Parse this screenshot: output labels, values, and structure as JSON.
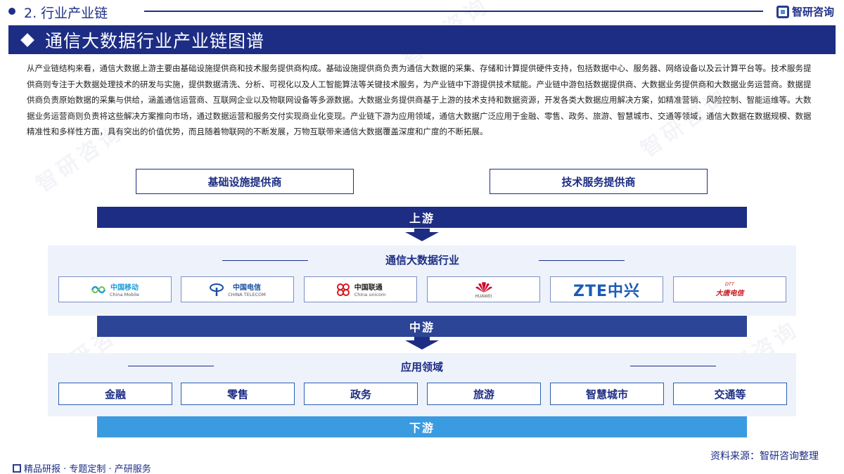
{
  "header": {
    "section": "2. 行业产业链",
    "brand": "智研咨询"
  },
  "title": "通信大数据行业产业链图谱",
  "intro": "从产业链结构来看，通信大数据上游主要由基础设施提供商和技术服务提供商构成。基础设施提供商负责为通信大数据的采集、存储和计算提供硬件支持，包括数据中心、服务器、网络设备以及云计算平台等。技术服务提供商则专注于大数据处理技术的研发与实施，提供数据清洗、分析、可视化以及人工智能算法等关键技术服务，为产业链中下游提供技术赋能。产业链中游包括数据提供商、大数据业务提供商和大数据业务运营商。数据提供商负责原始数据的采集与供给，涵盖通信运营商、互联网企业以及物联网设备等多源数据。大数据业务提供商基于上游的技术支持和数据资源，开发各类大数据应用解决方案，如精准营销、风险控制、智能运维等。大数据业务运营商则负责将这些解决方案推向市场，通过数据运营和服务交付实现商业化变现。产业链下游为应用领域，通信大数据广泛应用于金融、零售、政务、旅游、智慧城市、交通等领域，通信大数据在数据规模、数据精准性和多样性方面，具有突出的价值优势，而且随着物联网的不断发展，万物互联带来通信大数据覆盖深度和广度的不断拓展。",
  "upstream": {
    "items": [
      "基础设施提供商",
      "技术服务提供商"
    ],
    "label": "上游"
  },
  "midstream": {
    "title": "通信大数据行业",
    "label": "中游",
    "logos": [
      {
        "main": "中国移动",
        "sub": "China Mobile",
        "color": "#1a9cd8",
        "icon": "china-mobile-logo"
      },
      {
        "main": "中国电信",
        "sub": "CHINA TELECOM",
        "color": "#1a4fa0",
        "icon": "china-telecom-logo"
      },
      {
        "main": "中国联通",
        "sub": "China unicom",
        "color": "#222222",
        "icon": "china-unicom-logo"
      },
      {
        "main": "",
        "sub": "HUAWEI",
        "color": "#cf0a2c",
        "icon": "huawei-logo"
      },
      {
        "main": "ZTE中兴",
        "sub": "",
        "color": "#1c5bb5",
        "icon": "zte-logo"
      },
      {
        "main": "大唐电信",
        "sub": "DTT",
        "color": "#c8161d",
        "icon": "datang-telecom-logo"
      }
    ]
  },
  "downstream": {
    "title": "应用领域",
    "label": "下游",
    "items": [
      "金融",
      "零售",
      "政务",
      "旅游",
      "智慧城市",
      "交通等"
    ]
  },
  "footer": {
    "left": "精品研报 · 专题定制 · 产研服务",
    "source": "资料来源：智研咨询整理"
  },
  "colors": {
    "navy": "#1d2d84",
    "mid_bar": "#2c4596",
    "down_bar": "#3b9be0"
  }
}
